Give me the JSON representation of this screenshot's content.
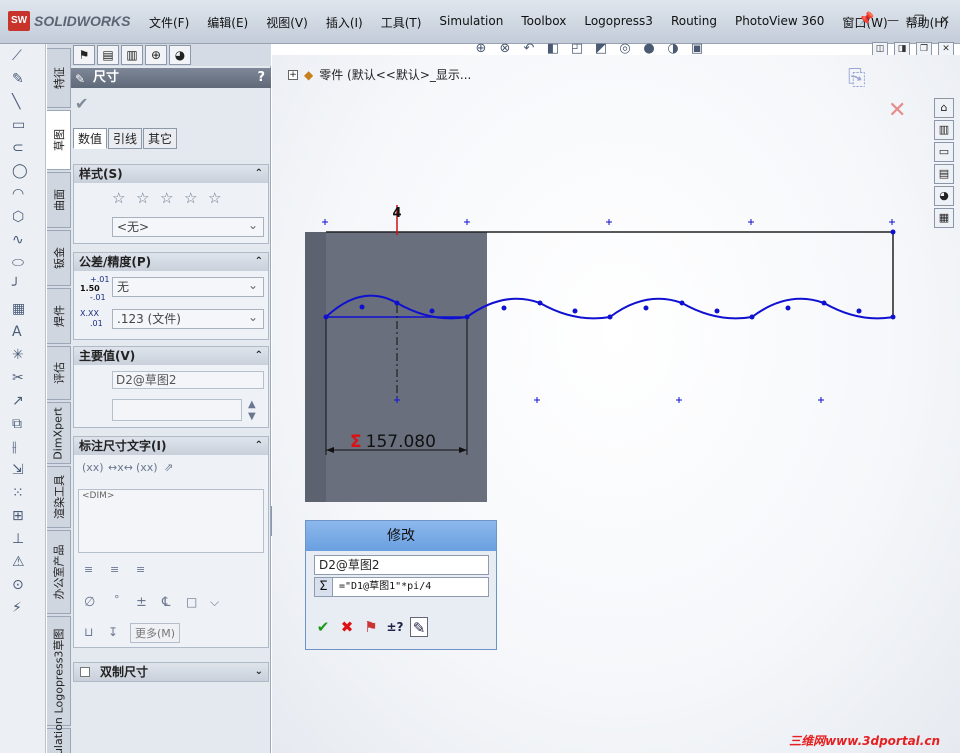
{
  "app": {
    "name": "SOLIDWORKS",
    "logo_mark": "SW"
  },
  "menu": [
    "文件(F)",
    "编辑(E)",
    "视图(V)",
    "插入(I)",
    "工具(T)",
    "Simulation",
    "Toolbox",
    "Logopress3",
    "Routing",
    "PhotoView 360",
    "窗口(W)",
    "帮助(H)"
  ],
  "command_tabs": [
    "特征",
    "草图",
    "曲面",
    "钣金",
    "焊件",
    "评估",
    "DimXpert",
    "渲染工具",
    "办公室产品",
    "Logopress3草图",
    "Simulation"
  ],
  "property_manager": {
    "title": "尺寸",
    "help": "?",
    "subtabs": [
      "数值",
      "引线",
      "其它"
    ],
    "style": {
      "header": "样式(S)",
      "dropdown": "<无>"
    },
    "tolerance": {
      "header": "公差/精度(P)",
      "tol_icon_top": "+.01",
      "tol_icon_mid": "1.50",
      "tol_icon_bot": "-.01",
      "tol_value": "无",
      "prec_icon_top": "X.XX",
      "prec_icon_bot": ".01",
      "prec_value": ".123 (文件)"
    },
    "primary": {
      "header": "主要值(V)",
      "name": "D2@草图2"
    },
    "dimtext": {
      "header": "标注尺寸文字(I)",
      "content": "<DIM>",
      "more": "更多(M)"
    },
    "dual": {
      "header": "双制尺寸"
    }
  },
  "tree": {
    "label": "零件  (默认<<默认>_显示..."
  },
  "dimension": {
    "value": "157.080",
    "top_label": "4"
  },
  "modify_dialog": {
    "title": "修改",
    "name": "D2@草图2",
    "value": "=\"D1@草图1\"*pi/4"
  },
  "watermark": "三维网www.3dportal.cn",
  "colors": {
    "sketch_line": "#1010d0",
    "panel": "#e4e8ef",
    "accent": "#6a9fe0",
    "error": "#d11111"
  }
}
